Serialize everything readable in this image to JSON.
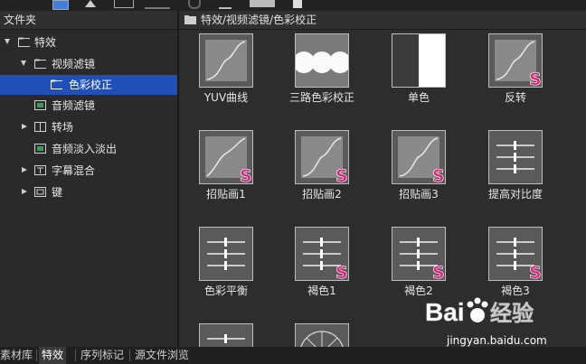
{
  "colors": {
    "selection": "#1e50b8",
    "s_badge": "#e0217d",
    "panel_bg": "#2d2d2d"
  },
  "left_panel": {
    "title": "文件夹",
    "tree": [
      {
        "label": "特效",
        "expanded": true
      },
      {
        "label": "视频滤镜",
        "expanded": true
      },
      {
        "label": "色彩校正",
        "selected": true
      },
      {
        "label": "音频滤镜"
      },
      {
        "label": "转场",
        "expanded": false
      },
      {
        "label": "音频淡入淡出"
      },
      {
        "label": "字幕混合",
        "expanded": false
      },
      {
        "label": "键",
        "expanded": false
      }
    ]
  },
  "right_panel": {
    "path": "特效/视频滤镜/色彩校正",
    "items": [
      {
        "label": "YUV曲线",
        "icon": "curve-icon",
        "badge": false
      },
      {
        "label": "三路色彩校正",
        "icon": "three-circles-icon",
        "badge": false
      },
      {
        "label": "单色",
        "icon": "monochrome-icon",
        "badge": false
      },
      {
        "label": "反转",
        "icon": "curve-icon",
        "badge": true
      },
      {
        "label": "招贴画1",
        "icon": "curve-icon",
        "badge": true
      },
      {
        "label": "招贴画2",
        "icon": "curve-icon",
        "badge": true
      },
      {
        "label": "招贴画3",
        "icon": "curve-icon",
        "badge": true
      },
      {
        "label": "提高对比度",
        "icon": "sliders-icon",
        "badge": false
      },
      {
        "label": "色彩平衡",
        "icon": "sliders-icon",
        "badge": false
      },
      {
        "label": "褐色1",
        "icon": "sliders-icon",
        "badge": true
      },
      {
        "label": "褐色2",
        "icon": "sliders-icon",
        "badge": true
      },
      {
        "label": "褐色3",
        "icon": "sliders-icon",
        "badge": true
      },
      {
        "label": "",
        "icon": "sliders-icon",
        "badge": false
      },
      {
        "label": "",
        "icon": "circle-icon",
        "badge": false
      }
    ],
    "badge_letter": "S"
  },
  "bottom_tabs": [
    {
      "label": "素材库",
      "active": false
    },
    {
      "label": "特效",
      "active": true
    },
    {
      "label": "序列标记",
      "active": false
    },
    {
      "label": "源文件浏览",
      "active": false
    }
  ],
  "watermark": {
    "brand": "Bai",
    "brand2": "经验",
    "url": "jingyan.baidu.com"
  }
}
